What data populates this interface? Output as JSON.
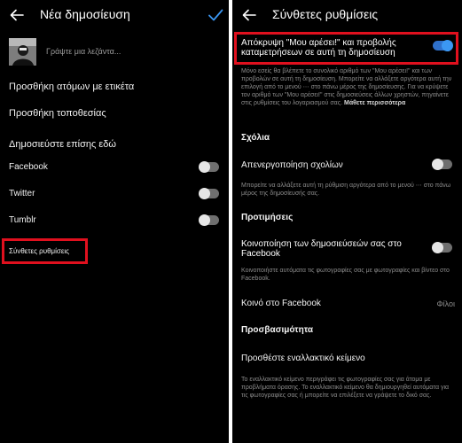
{
  "left": {
    "header": {
      "title": "Νέα δημοσίευση"
    },
    "caption_placeholder": "Γράψτε μια λεζάντα...",
    "tag_people": "Προσθήκη ατόμων με ετικέτα",
    "add_location": "Προσθήκη τοποθεσίας",
    "share_heading": "Δημοσιεύστε επίσης εδώ",
    "share_targets": [
      {
        "label": "Facebook",
        "on": false
      },
      {
        "label": "Twitter",
        "on": false
      },
      {
        "label": "Tumblr",
        "on": false
      }
    ],
    "advanced_settings": "Σύνθετες ρυθμίσεις"
  },
  "right": {
    "header": {
      "title": "Σύνθετες ρυθμίσεις"
    },
    "hide_likes": {
      "title": "Απόκρυψη \"Μου αρέσει!\" και προβολής καταμετρήσεων σε αυτή τη δημοσίευση",
      "on": true,
      "description": "Μόνο εσείς θα βλέπετε το συνολικό αριθμό των \"Μου αρέσει!\" και των προβολών σε αυτή τη δημοσίευση. Μπορείτε να αλλάξετε αργότερα αυτή την επιλογή από το μενού ⋯ στο πάνω μέρος της δημοσίευσης. Για να κρύψετε τον αριθμό των \"Μου αρέσει!\" στις δημοσιεύσεις άλλων χρηστών, πηγαίνετε στις ρυθμίσεις του λογαριασμού σας.",
      "learn_more": "Μάθετε περισσότερα"
    },
    "comments": {
      "heading": "Σχόλια",
      "turn_off": "Απενεργοποίηση σχολίων",
      "on": false,
      "description": "Μπορείτε να αλλάξετε αυτή τη ρύθμιση αργότερα από το μενού ⋯ στο πάνω μέρος της δημοσίευσής σας."
    },
    "preferences": {
      "heading": "Προτιμήσεις",
      "share_fb": "Κοινοποίηση των δημοσιεύσεών σας στο Facebook",
      "on": false,
      "description": "Κοινοποιήστε αυτόματα τις φωτογραφίες σας με φωτογραφίες και βίντεο στο Facebook.",
      "audience_label": "Κοινό στο Facebook",
      "audience_value": "Φίλοι"
    },
    "accessibility": {
      "heading": "Προσβασιμότητα",
      "alt_text": "Προσθέστε εναλλακτικό κείμενο",
      "description": "Το εναλλακτικό κείμενο περιγράφει τις φωτογραφίες σας για άτομα με προβλήματα όρασης. Το εναλλακτικό κείμενο θα δημιουργηθεί αυτόματα για τις φωτογραφίες σας ή μπορείτε να επιλέξετε να γράψετε το δικό σας."
    }
  },
  "colors": {
    "background": "#000000",
    "accent_blue": "#3b97f3",
    "highlight_red": "#e0101e"
  }
}
